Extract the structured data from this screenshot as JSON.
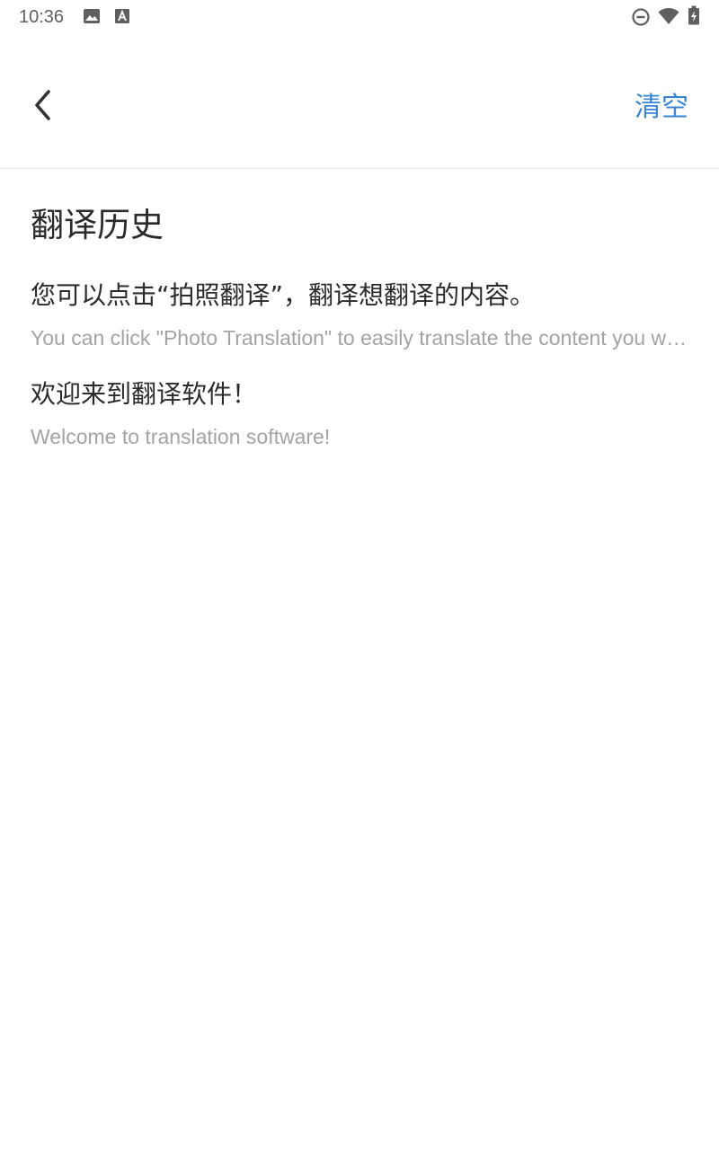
{
  "status_bar": {
    "time": "10:36",
    "icons": [
      "image-icon",
      "font-a-icon",
      "do-not-disturb-icon",
      "wifi-icon",
      "battery-charging-icon"
    ]
  },
  "toolbar": {
    "back_icon": "chevron-left-icon",
    "clear_label": "清空",
    "accent_color": "#3a86d4"
  },
  "page": {
    "title": "翻译历史"
  },
  "history": {
    "items": [
      {
        "source": "您可以点击“拍照翻译”，翻译想翻译的内容。",
        "target": "You can click \"Photo Translation\" to easily translate the content you want to translate."
      },
      {
        "source": "欢迎来到翻译软件！",
        "target": "Welcome to translation software!"
      }
    ]
  }
}
